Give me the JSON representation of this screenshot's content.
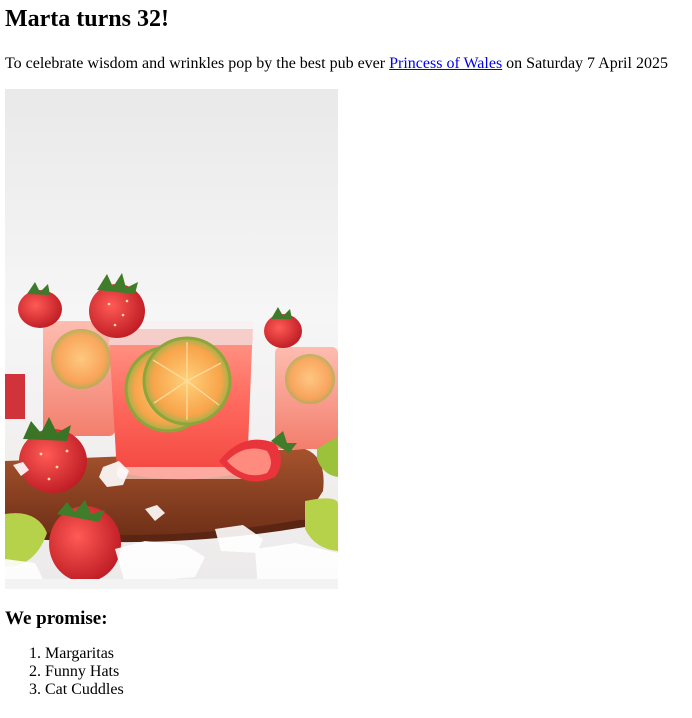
{
  "invite": {
    "title": "Marta turns 32!",
    "intro_before": "To celebrate wisdom and wrinkles pop by the best pub ever ",
    "link_text": "Princess of Wales",
    "intro_after": " on Saturday 7 April 2025",
    "photo_subject": "strawberry-margarita-drinks",
    "promise_heading": "We promise:",
    "promises": [
      "Margaritas",
      "Funny Hats",
      "Cat Cuddles"
    ]
  }
}
